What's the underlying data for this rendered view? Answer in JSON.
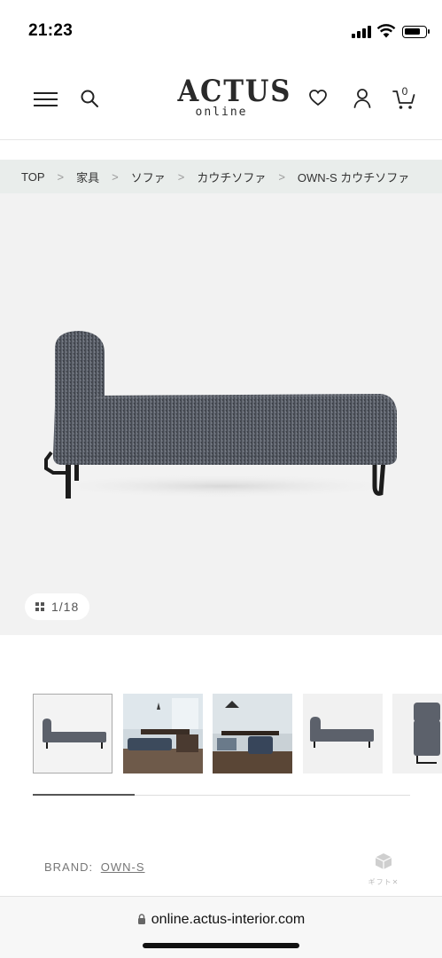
{
  "status_bar": {
    "time": "21:23",
    "battery_level": 0.8
  },
  "header": {
    "logo_main": "ACTUS",
    "logo_sub": "online",
    "cart_count": "0",
    "icons": [
      "menu-icon",
      "search-icon",
      "heart-icon",
      "user-icon",
      "cart-icon"
    ]
  },
  "breadcrumb": {
    "separator": ">",
    "items": [
      "TOP",
      "家具",
      "ソファ",
      "カウチソファ",
      "OWN-S カウチソファ"
    ]
  },
  "gallery": {
    "counter": "1/18",
    "current_index": 1,
    "total": 18,
    "thumbnail_count": 5,
    "progress_fraction": 0.27
  },
  "product": {
    "brand_label": "BRAND:",
    "brand_name": "OWN-S",
    "gift_label": "ギフト✕"
  },
  "browser": {
    "url": "online.actus-interior.com"
  },
  "colors": {
    "breadcrumb_bg": "#e9edeb",
    "hero_bg": "#f2f2f2",
    "sofa_fabric": "#5a5f68"
  }
}
